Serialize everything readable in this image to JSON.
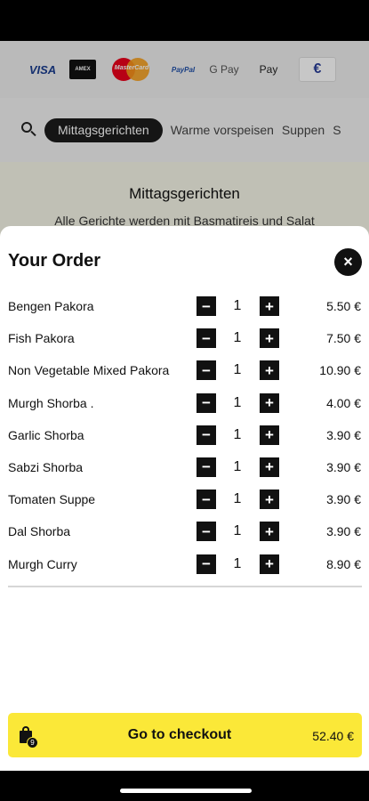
{
  "payment_methods": {
    "visa": "VISA",
    "amex": "AMEX",
    "mastercard": "MasterCard",
    "paypal": "PayPal",
    "gpay": "G Pay",
    "applepay": "Pay",
    "ec": "€"
  },
  "categories": {
    "active": "Mittagsgerichten",
    "tabs": [
      "Warme vorspeisen",
      "Suppen",
      "S"
    ]
  },
  "section": {
    "title": "Mittagsgerichten",
    "subtitle": "Alle Gerichte werden mit Basmatireis und Salat"
  },
  "order": {
    "title": "Your Order",
    "close": "×",
    "items": [
      {
        "name": "Bengen Pakora",
        "qty": "1",
        "price": "5.50 €"
      },
      {
        "name": "Fish Pakora",
        "qty": "1",
        "price": "7.50 €"
      },
      {
        "name": "Non Vegetable Mixed Pakora",
        "qty": "1",
        "price": "10.90 €"
      },
      {
        "name": "Murgh Shorba .",
        "qty": "1",
        "price": "4.00 €"
      },
      {
        "name": "Garlic Shorba",
        "qty": "1",
        "price": "3.90 €"
      },
      {
        "name": "Sabzi Shorba",
        "qty": "1",
        "price": "3.90 €"
      },
      {
        "name": "Tomaten Suppe",
        "qty": "1",
        "price": "3.90 €"
      },
      {
        "name": "Dal Shorba",
        "qty": "1",
        "price": "3.90 €"
      },
      {
        "name": "Murgh Curry",
        "qty": "1",
        "price": "8.90 €"
      }
    ],
    "minus_symbol": "−",
    "plus_symbol": "+"
  },
  "checkout": {
    "label": "Go to checkout",
    "total": "52.40 €",
    "item_count": "9"
  },
  "colors": {
    "accent": "#fbe838",
    "dark": "#111111"
  }
}
